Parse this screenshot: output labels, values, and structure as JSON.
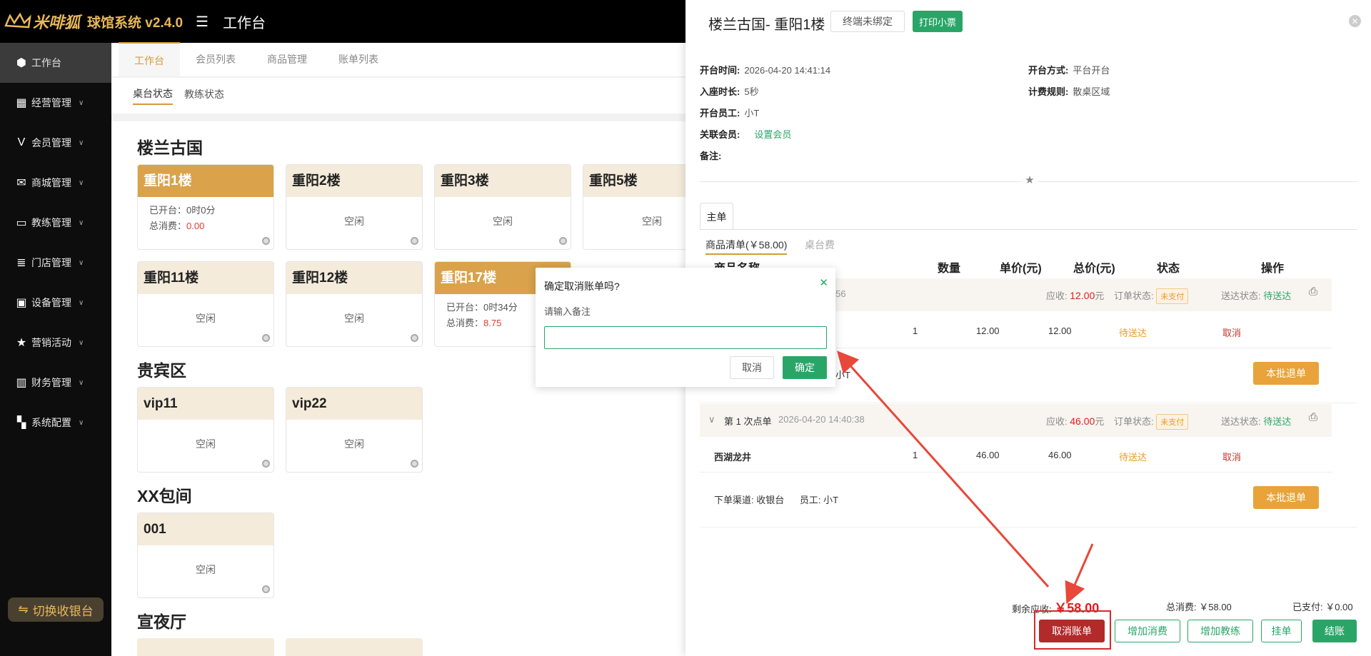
{
  "header": {
    "logo_text": "米啡狐",
    "app_name": "球馆系统 v2.4.0",
    "menu_icon": "menu-fold-icon",
    "page_title": "工作台"
  },
  "sidebar": {
    "items": [
      {
        "label": "工作台",
        "icon": "cube-icon",
        "active": true
      },
      {
        "label": "经营管理",
        "icon": "store-icon"
      },
      {
        "label": "会员管理",
        "icon": "v-icon"
      },
      {
        "label": "商城管理",
        "icon": "mall-icon"
      },
      {
        "label": "教练管理",
        "icon": "coach-icon"
      },
      {
        "label": "门店管理",
        "icon": "coins-icon"
      },
      {
        "label": "设备管理",
        "icon": "device-icon"
      },
      {
        "label": "营销活动",
        "icon": "star-icon"
      },
      {
        "label": "财务管理",
        "icon": "finance-icon"
      },
      {
        "label": "系统配置",
        "icon": "grid-icon"
      }
    ],
    "switch_btn": "切换收银台"
  },
  "tabs": [
    "工作台",
    "会员列表",
    "商品管理",
    "账单列表"
  ],
  "subtabs": [
    "桌台状态",
    "教练状态"
  ],
  "areas": [
    {
      "name": "楼兰古国",
      "tables": [
        {
          "name": "重阳1楼",
          "busy": true,
          "open_label": "已开台：",
          "open_time": "0时0分",
          "spend_label": "总消费：",
          "spend": "0.00"
        },
        {
          "name": "重阳2楼",
          "status": "空闲"
        },
        {
          "name": "重阳3楼",
          "status": "空闲"
        },
        {
          "name": "重阳5楼",
          "status": "空闲"
        },
        {
          "name": "重阳11楼",
          "status": "空闲"
        },
        {
          "name": "重阳12楼",
          "status": "空闲"
        },
        {
          "name": "重阳17楼",
          "busy": true,
          "open_label": "已开台：",
          "open_time": "0时34分",
          "spend_label": "总消费：",
          "spend": "8.75"
        }
      ]
    },
    {
      "name": "贵宾区",
      "tables": [
        {
          "name": "vip11",
          "status": "空闲"
        },
        {
          "name": "vip22",
          "status": "空闲"
        }
      ]
    },
    {
      "name": "XX包间",
      "tables": [
        {
          "name": "001",
          "status": "空闲"
        }
      ]
    },
    {
      "name": "宣夜厅",
      "tables": []
    }
  ],
  "drawer": {
    "title": "楼兰古国- 重阳1楼",
    "terminal_btn": "终端未绑定",
    "print_btn": "打印小票",
    "info": {
      "open_time_label": "开台时间:",
      "open_time": "2026-04-20 14:41:14",
      "duration_label": "入座时长:",
      "duration": "5秒",
      "staff_label": "开台员工:",
      "staff": "小T",
      "member_label": "关联会员:",
      "member_link": "设置会员",
      "note_label": "备注:",
      "open_mode_label": "开台方式:",
      "open_mode": "平台开台",
      "billing_label": "计费规则:",
      "billing": "散桌区域"
    },
    "main_tab": "主单",
    "list_tab": "商品清单(￥58.00)",
    "table_fee_tab": "桌台费",
    "columns": [
      "商品名称",
      "数量",
      "单价(元)",
      "总价(元)",
      "状态",
      "操作"
    ],
    "orders": [
      {
        "time": "14:40:56",
        "receivable_label": "应收:",
        "receivable": "12.00",
        "unit": "元",
        "order_status_label": "订单状态:",
        "order_status": "未支付",
        "delivery_label": "送达状态:",
        "delivery": "待送达",
        "items": [
          {
            "name": "",
            "qty": "1",
            "price": "12.00",
            "total": "12.00",
            "status": "待送达",
            "op": "取消"
          }
        ],
        "footer_text": "小T",
        "refund_btn": "本批退单"
      },
      {
        "header": "第 1 次点单",
        "time": "2026-04-20 14:40:38",
        "receivable_label": "应收:",
        "receivable": "46.00",
        "unit": "元",
        "order_status_label": "订单状态:",
        "order_status": "未支付",
        "delivery_label": "送达状态:",
        "delivery": "待送达",
        "items": [
          {
            "name": "西湖龙井",
            "qty": "1",
            "price": "46.00",
            "total": "46.00",
            "status": "待送达",
            "op": "取消"
          }
        ],
        "channel_label": "下单渠道:",
        "channel": "收银台",
        "staff_label": "员工:",
        "staff": "小T",
        "refund_btn": "本批退单"
      }
    ],
    "footer": {
      "remaining_label": "剩余应收:",
      "remaining": "￥58.00",
      "total_label": "总消费:",
      "total": "￥58.00",
      "paid_label": "已支付:",
      "paid": "￥0.00"
    },
    "actions": [
      "取消账单",
      "增加消费",
      "增加教练",
      "挂单",
      "结账"
    ]
  },
  "dialog": {
    "title": "确定取消账单吗?",
    "label": "请输入备注",
    "input_value": "",
    "cancel": "取消",
    "ok": "确定"
  },
  "colors": {
    "accent": "#d49a3a",
    "green": "#2aa568",
    "red": "#e21d1d",
    "annotation": "#e8473a"
  }
}
